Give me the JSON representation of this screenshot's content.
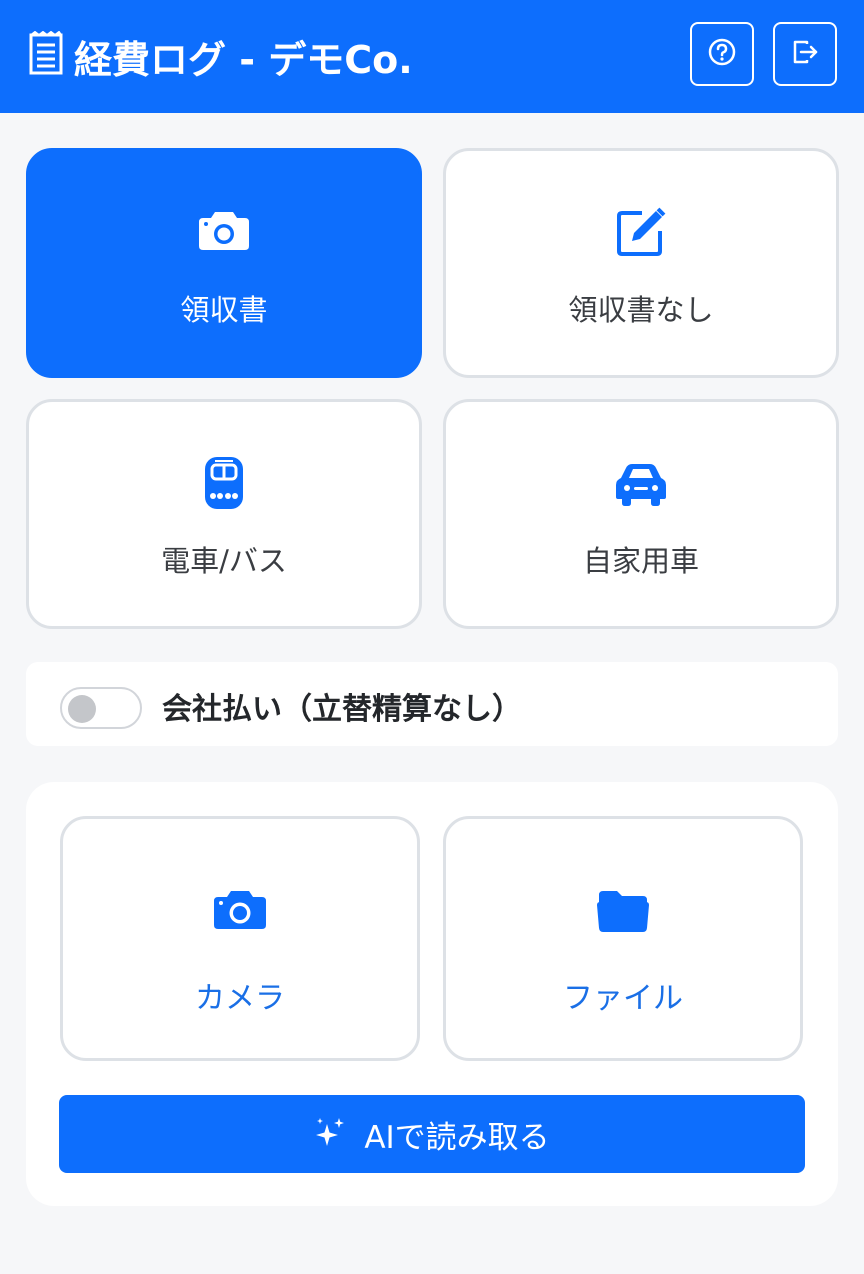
{
  "header": {
    "title": "経費ログ - デモCo.",
    "help_icon": "question-circle-icon",
    "logout_icon": "box-arrow-right-icon"
  },
  "expense_types": [
    {
      "label": "領収書",
      "icon": "camera-icon",
      "selected": true
    },
    {
      "label": "領収書なし",
      "icon": "pencil-square-icon",
      "selected": false
    },
    {
      "label": "電車/バス",
      "icon": "train-icon",
      "selected": false
    },
    {
      "label": "自家用車",
      "icon": "car-icon",
      "selected": false
    }
  ],
  "company_payment": {
    "label": "会社払い（立替精算なし）",
    "enabled": false
  },
  "upload": {
    "camera_label": "カメラ",
    "file_label": "ファイル",
    "ai_button_label": "AIで読み取る"
  },
  "colors": {
    "primary": "#0d6efd",
    "background": "#f6f7f9",
    "border": "#dde1e6"
  }
}
